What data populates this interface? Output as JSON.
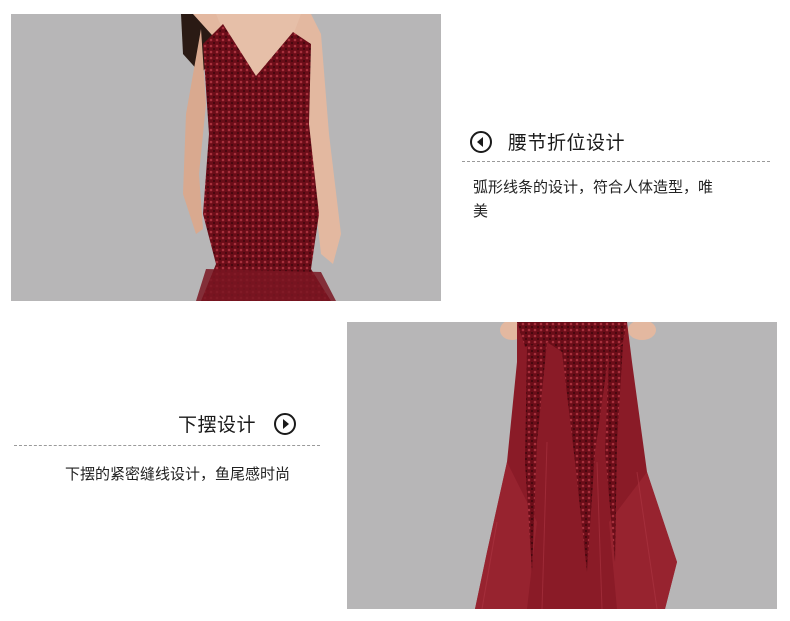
{
  "section_top": {
    "title": "腰节折位设计",
    "description": "弧形线条的设计，符合人体造型，唯美",
    "icon": "chevron-left-circle-icon"
  },
  "section_bottom": {
    "title": "下摆设计",
    "description": "下摆的紧密缝线设计，鱼尾感时尚",
    "icon": "chevron-right-circle-icon"
  },
  "colors": {
    "photo_background": "#b7b6b7",
    "dress": "#6e0f1a",
    "text": "#1a1a1a",
    "divider": "#9a9a9a"
  }
}
